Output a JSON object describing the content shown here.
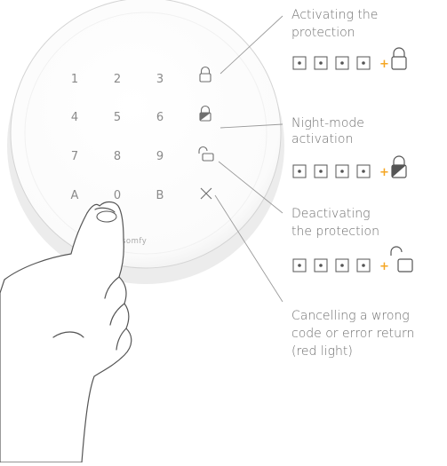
{
  "keypad": {
    "digits": [
      {
        "id": "1",
        "label": "1"
      },
      {
        "id": "2",
        "label": "2"
      },
      {
        "id": "3",
        "label": "3"
      },
      {
        "id": "4",
        "label": "4"
      },
      {
        "id": "5",
        "label": "5"
      },
      {
        "id": "6",
        "label": "6"
      },
      {
        "id": "7",
        "label": "7"
      },
      {
        "id": "8",
        "label": "8"
      },
      {
        "id": "9",
        "label": "9"
      },
      {
        "id": "a",
        "label": "A"
      },
      {
        "id": "0",
        "label": "0"
      },
      {
        "id": "b",
        "label": "B"
      }
    ],
    "brand": "somfy"
  },
  "callouts": [
    {
      "id": "activate",
      "lines": [
        "Activating the",
        "protection"
      ],
      "icon": "lock-closed-icon"
    },
    {
      "id": "night",
      "lines": [
        "Night-mode",
        "activation"
      ],
      "icon": "lock-half-filled-icon"
    },
    {
      "id": "deactivate",
      "lines": [
        "Deactivating",
        "the protection"
      ],
      "icon": "lock-open-icon"
    },
    {
      "id": "cancel",
      "lines": [
        "Cancelling a wrong",
        "code or error return",
        "(red light)"
      ],
      "icon": "cross-icon"
    }
  ],
  "code_sequence": {
    "plus_sign": "+",
    "code_length": 4
  },
  "colors": {
    "plus": "#f5a623",
    "ink": "#555555",
    "line": "#9a9a9a",
    "device_shadow": "#e6e6e6"
  }
}
